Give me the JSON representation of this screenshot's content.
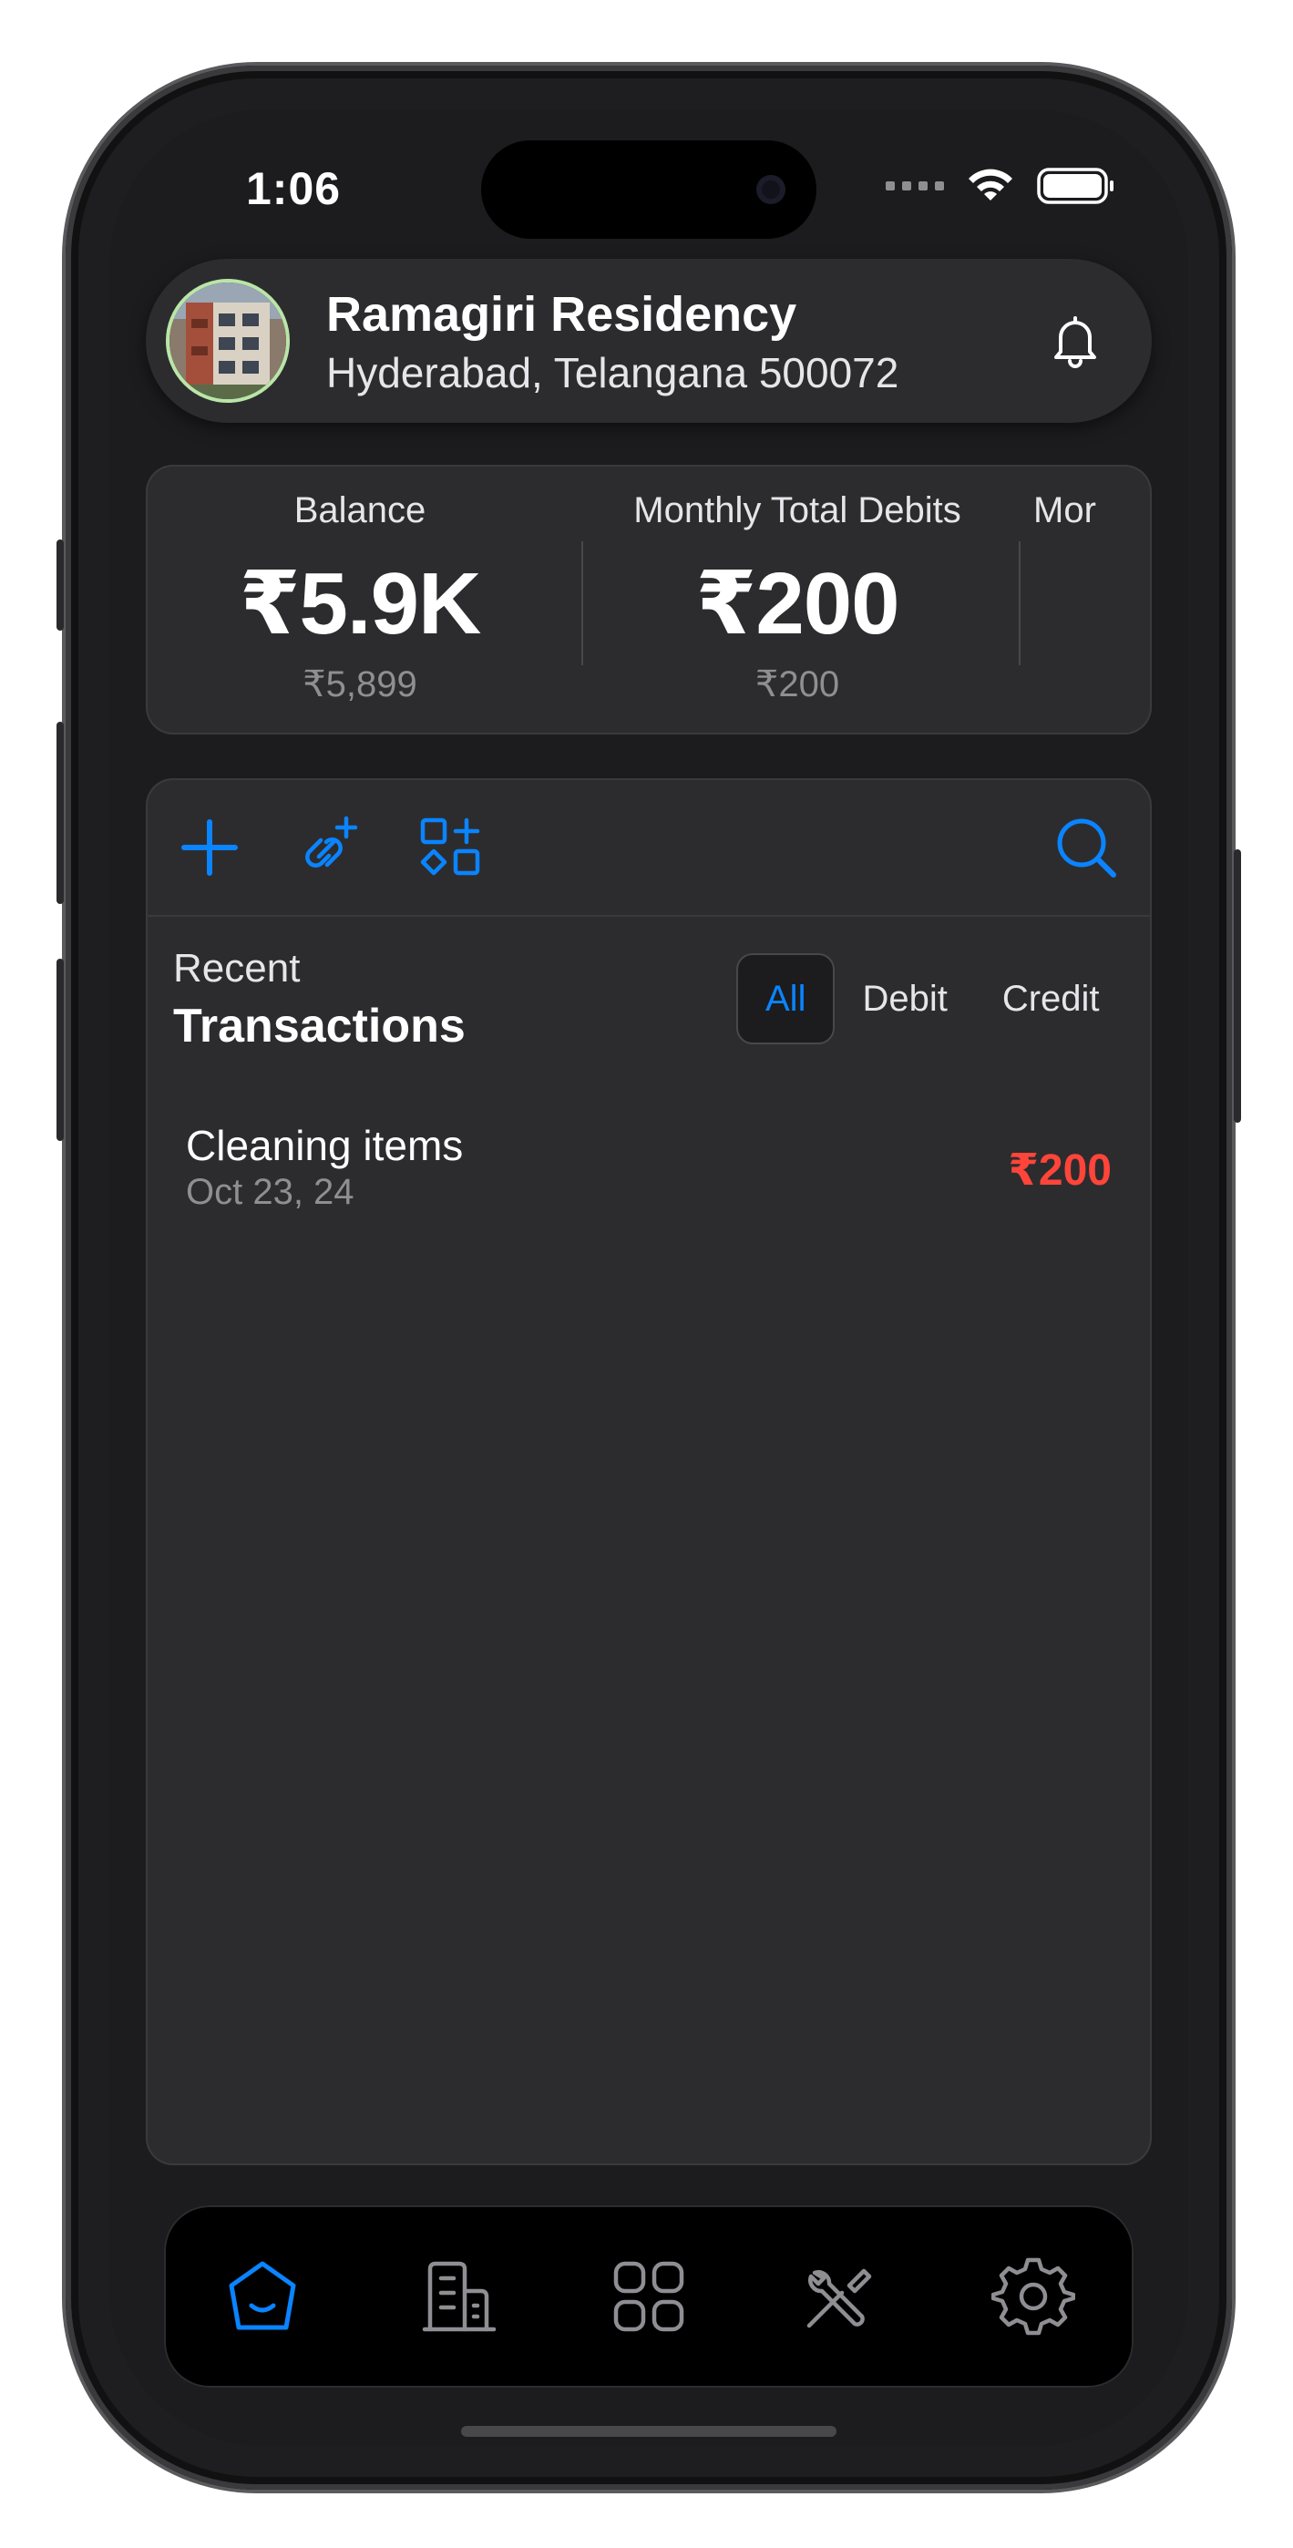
{
  "status_bar": {
    "time": "1:06"
  },
  "header": {
    "title": "Ramagiri Residency",
    "subtitle": "Hyderabad, Telangana 500072",
    "bell_icon": "bell-icon"
  },
  "stats": [
    {
      "label": "Balance",
      "value_short": "₹5.9K",
      "value_full": "₹5,899"
    },
    {
      "label": "Monthly Total Debits",
      "value_short": "₹200",
      "value_full": "₹200"
    },
    {
      "label": "Mor"
    }
  ],
  "toolbar": {
    "icons": [
      "plus-icon",
      "link-add-icon",
      "shapes-add-icon",
      "search-icon"
    ]
  },
  "transactions": {
    "heading_small": "Recent",
    "heading_large": "Transactions",
    "filters": [
      "All",
      "Debit",
      "Credit"
    ],
    "selected_filter": "All",
    "items": [
      {
        "name": "Cleaning items",
        "date": "Oct 23, 24",
        "amount": "₹200"
      }
    ]
  },
  "tabbar": {
    "tabs": [
      "home-icon",
      "building-icon",
      "grid-icon",
      "tools-icon",
      "settings-icon"
    ],
    "active": "home-icon"
  },
  "colors": {
    "accent": "#0a84ff",
    "debit": "#ff453a",
    "background": "#1c1c1e",
    "card": "#2c2c2e"
  }
}
